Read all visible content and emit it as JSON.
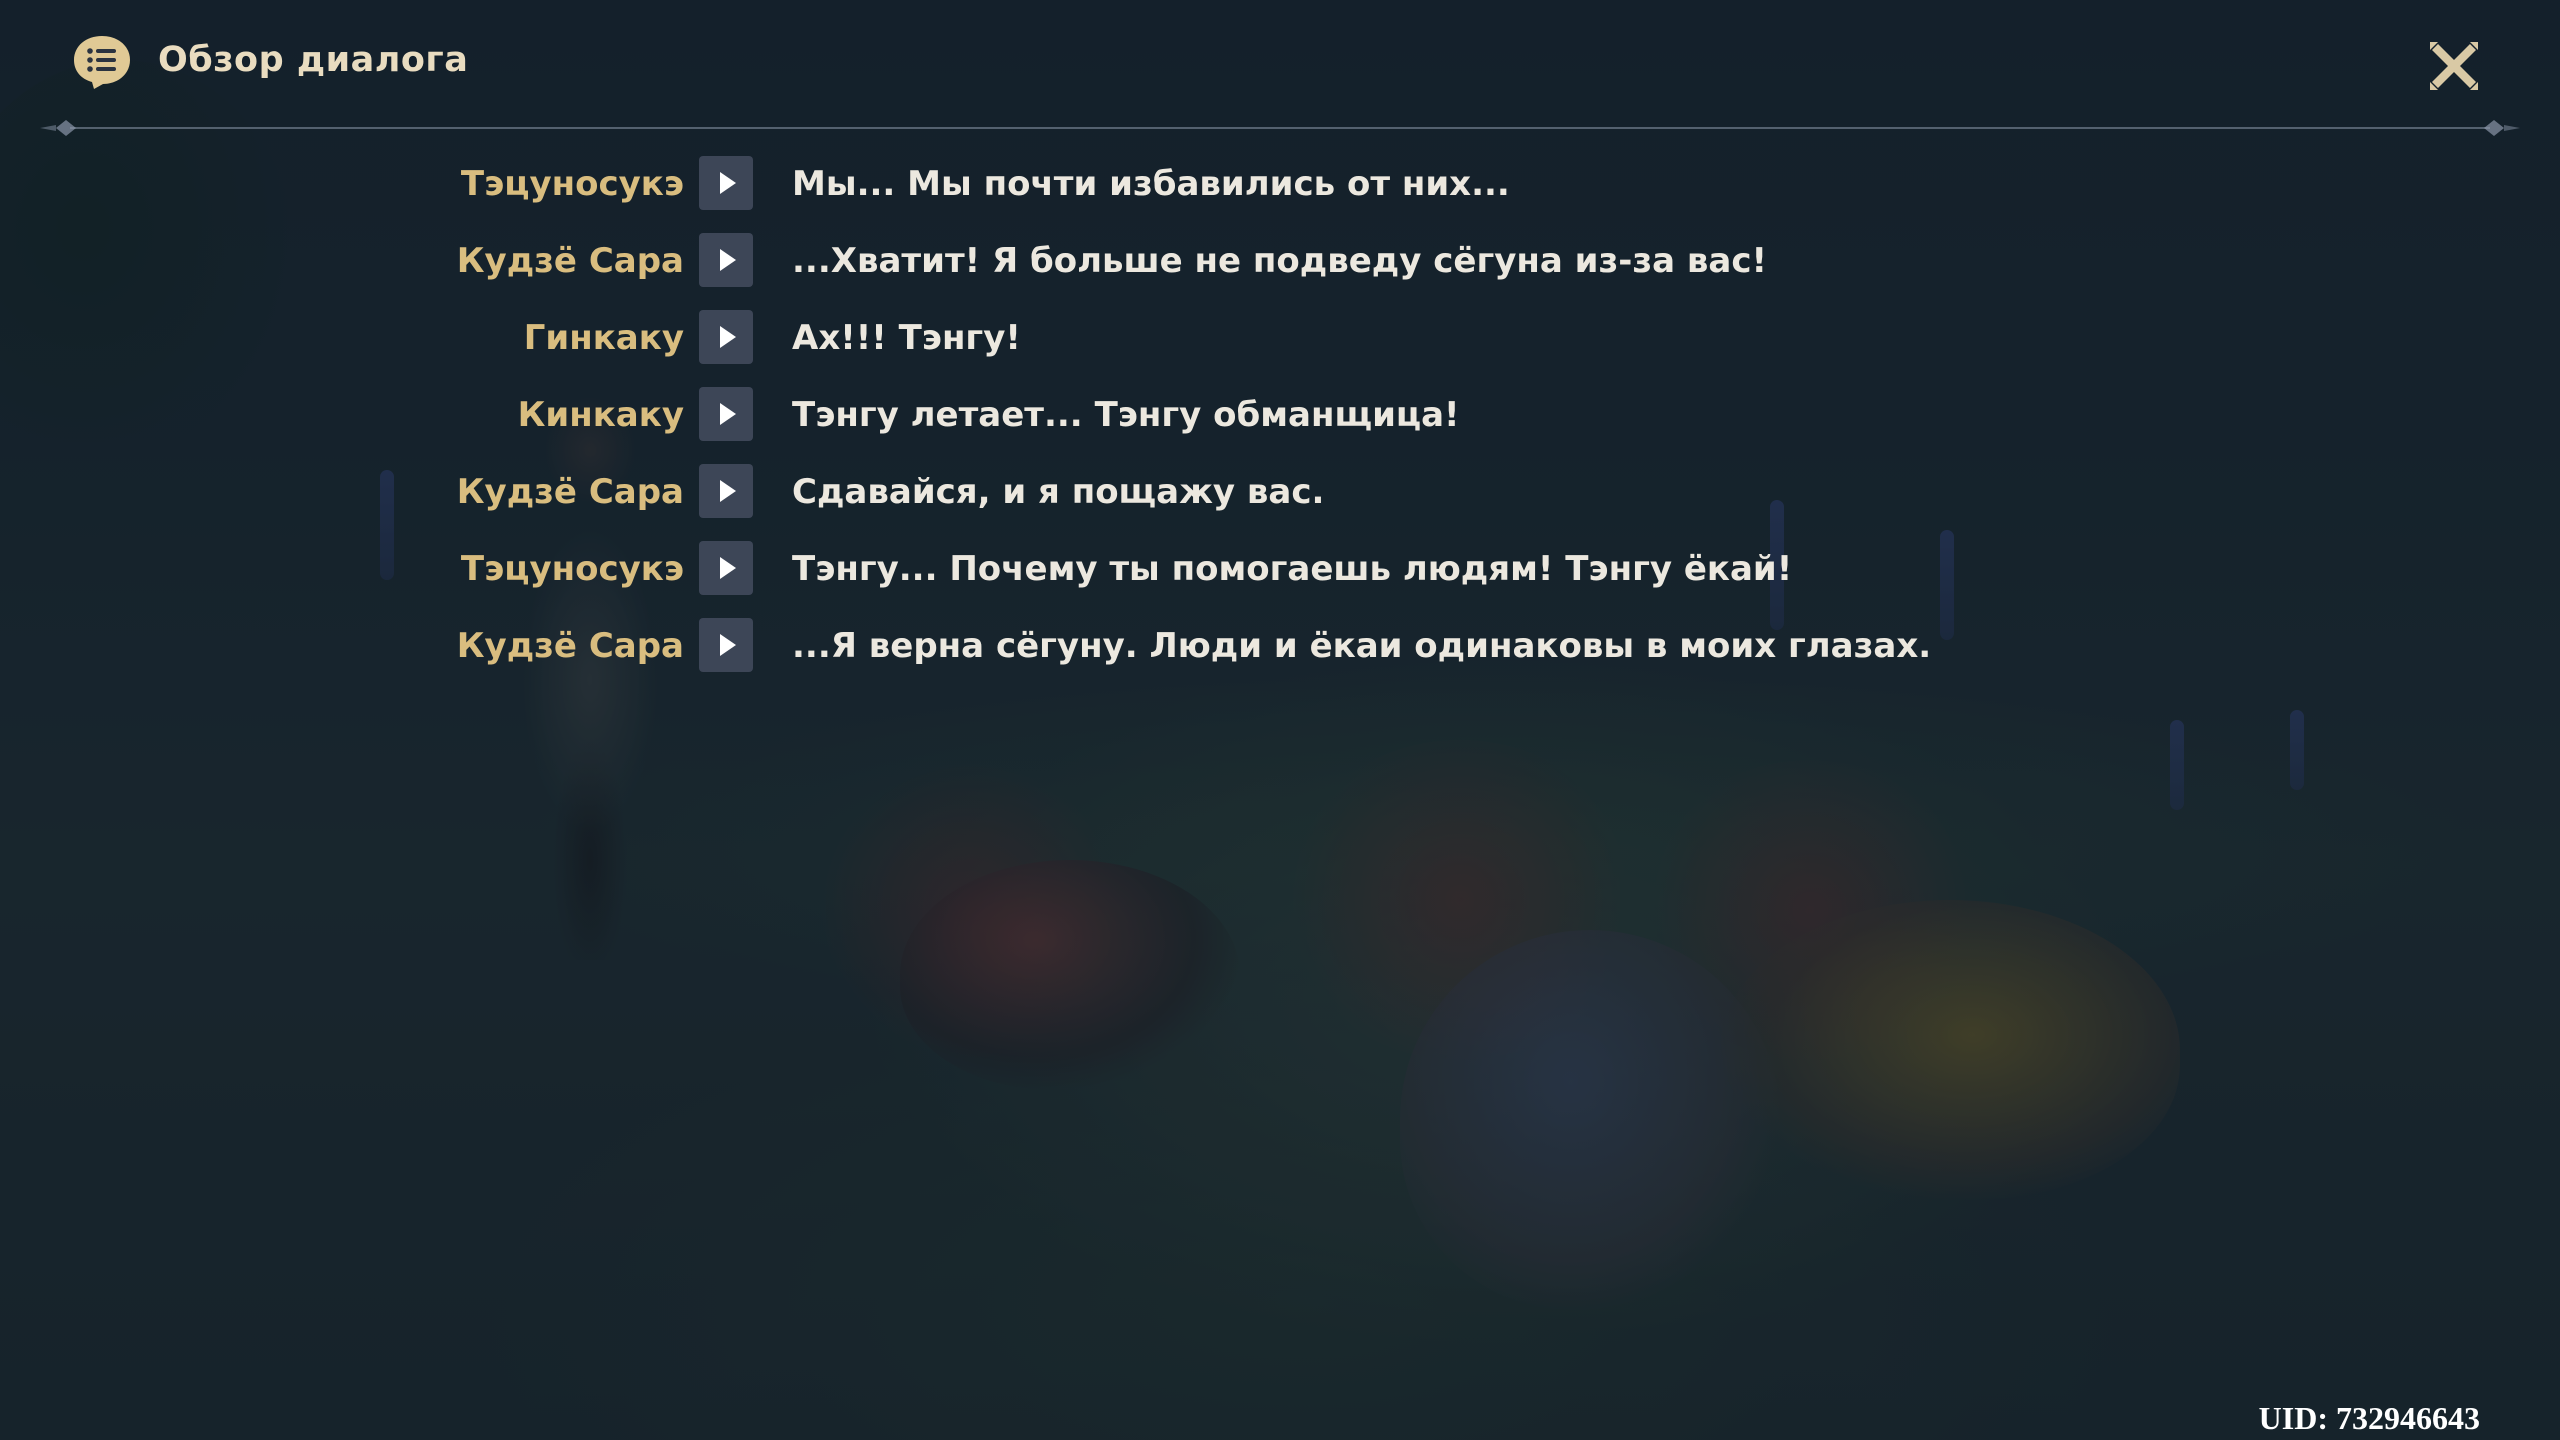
{
  "header": {
    "title": "Обзор диалога",
    "icon": "dialog-log-icon",
    "close_icon": "close-icon"
  },
  "colors": {
    "accent": "#d9bd7f",
    "title": "#e9dcc0",
    "text": "#ece8df",
    "button_bg": "#3d4657"
  },
  "dialog": [
    {
      "speaker": "Тэцуносукэ",
      "text": "Мы... Мы почти избавились от них..."
    },
    {
      "speaker": "Кудзё Сара",
      "text": "...Хватит! Я больше не подведу сёгуна из-за вас!"
    },
    {
      "speaker": "Гинкаку",
      "text": "Ах!!! Тэнгу!"
    },
    {
      "speaker": "Кинкаку",
      "text": "Тэнгу летает... Тэнгу обманщица!"
    },
    {
      "speaker": "Кудзё Сара",
      "text": "Сдавайся, и я пощажу вас."
    },
    {
      "speaker": "Тэцуносукэ",
      "text": "Тэнгу... Почему ты помогаешь людям! Тэнгу ёкай!"
    },
    {
      "speaker": "Кудзё Сара",
      "text": "...Я верна сёгуну. Люди и ёкаи одинаковы в моих глазах."
    }
  ],
  "footer": {
    "uid": "UID: 732946643"
  }
}
